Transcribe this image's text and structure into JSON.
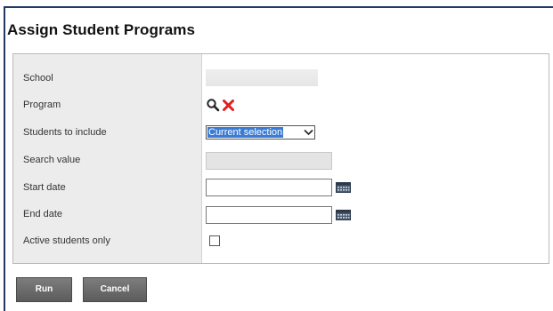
{
  "dialog": {
    "title": "Assign Student Programs"
  },
  "form": {
    "school": {
      "label": "School",
      "value": ""
    },
    "program": {
      "label": "Program",
      "search_icon": "search-icon",
      "clear_icon": "close-icon"
    },
    "students_to_include": {
      "label": "Students to include",
      "selected": "Current selection"
    },
    "search_value": {
      "label": "Search value",
      "value": ""
    },
    "start_date": {
      "label": "Start date",
      "value": "",
      "calendar_icon": "calendar-icon"
    },
    "end_date": {
      "label": "End date",
      "value": "",
      "calendar_icon": "calendar-icon"
    },
    "active_only": {
      "label": "Active students only",
      "checked": false
    }
  },
  "buttons": {
    "run_label": "Run",
    "cancel_label": "Cancel"
  },
  "colors": {
    "title_border": "#1f3b64",
    "label_column": "#ececec",
    "select_highlight": "#3a7bd5",
    "close_icon": "#e02020",
    "button": "#6b6b6b"
  }
}
